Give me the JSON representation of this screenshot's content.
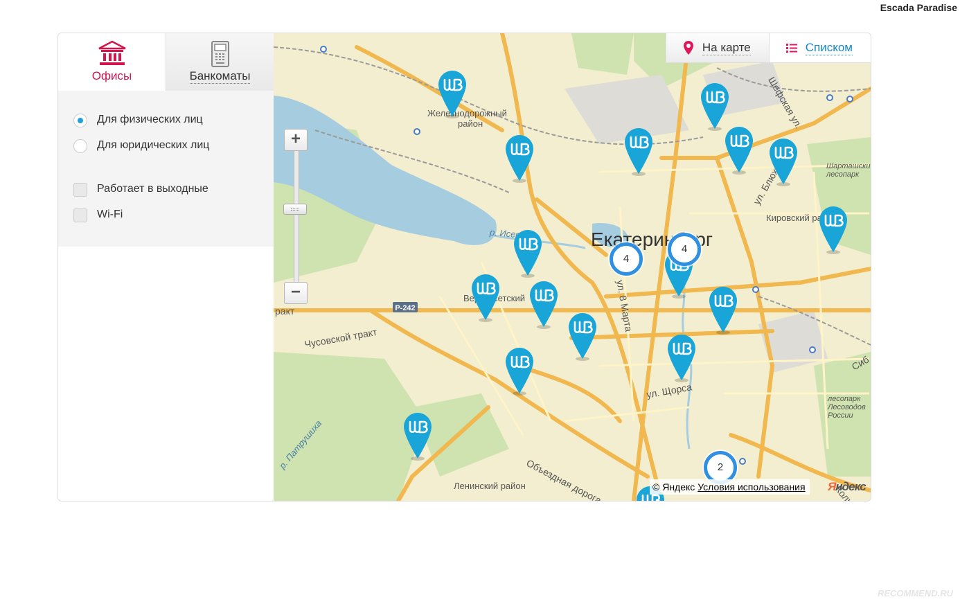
{
  "author": "Escada Paradise",
  "tabs": {
    "offices": "Офисы",
    "atms": "Банкоматы"
  },
  "filters": {
    "individuals": "Для физических лиц",
    "legal": "Для юридических лиц",
    "weekends": "Работает в выходные",
    "wifi": "Wi-Fi",
    "selected": "individuals"
  },
  "view": {
    "map": "На карте",
    "list": "Списком"
  },
  "map": {
    "labels": {
      "city": "Екатеринбург",
      "railway_district_1": "Железнодорожный",
      "railway_district_2": "район",
      "verkh_isetsky": "Верх-Исетский",
      "kirovsky": "Кировский район",
      "leninsky": "Ленинский район",
      "chusovskoy": "Чусовской тракт",
      "r242": "Р-242",
      "trakt": "ракт",
      "iset": "р. Исеть",
      "patrushikha": "р. Патрушиха",
      "march8": "ул. 8 Марта",
      "schorsa": "ул. Щорса",
      "blukhera": "ул. Блюхе",
      "shefskaya": "Шефская ул.",
      "obezdnaya": "Объездная дорога",
      "shartash": "Шарташский лесопарк",
      "lesopark_ru": "лесопарк Лесоводов России",
      "kolts": "Кольц",
      "sib": "Сиб"
    },
    "clusters": [
      "4",
      "4",
      "2"
    ],
    "copyright": "© Яндекс",
    "terms": "Условия использования",
    "logo_y": "Я",
    "logo_rest": "ндекс"
  },
  "watermark": "RECOMMEND.RU",
  "colors": {
    "accent": "#d2154a",
    "link": "#1588c4",
    "pin": "#1aa5d8",
    "cluster": "#2f8fe0"
  }
}
